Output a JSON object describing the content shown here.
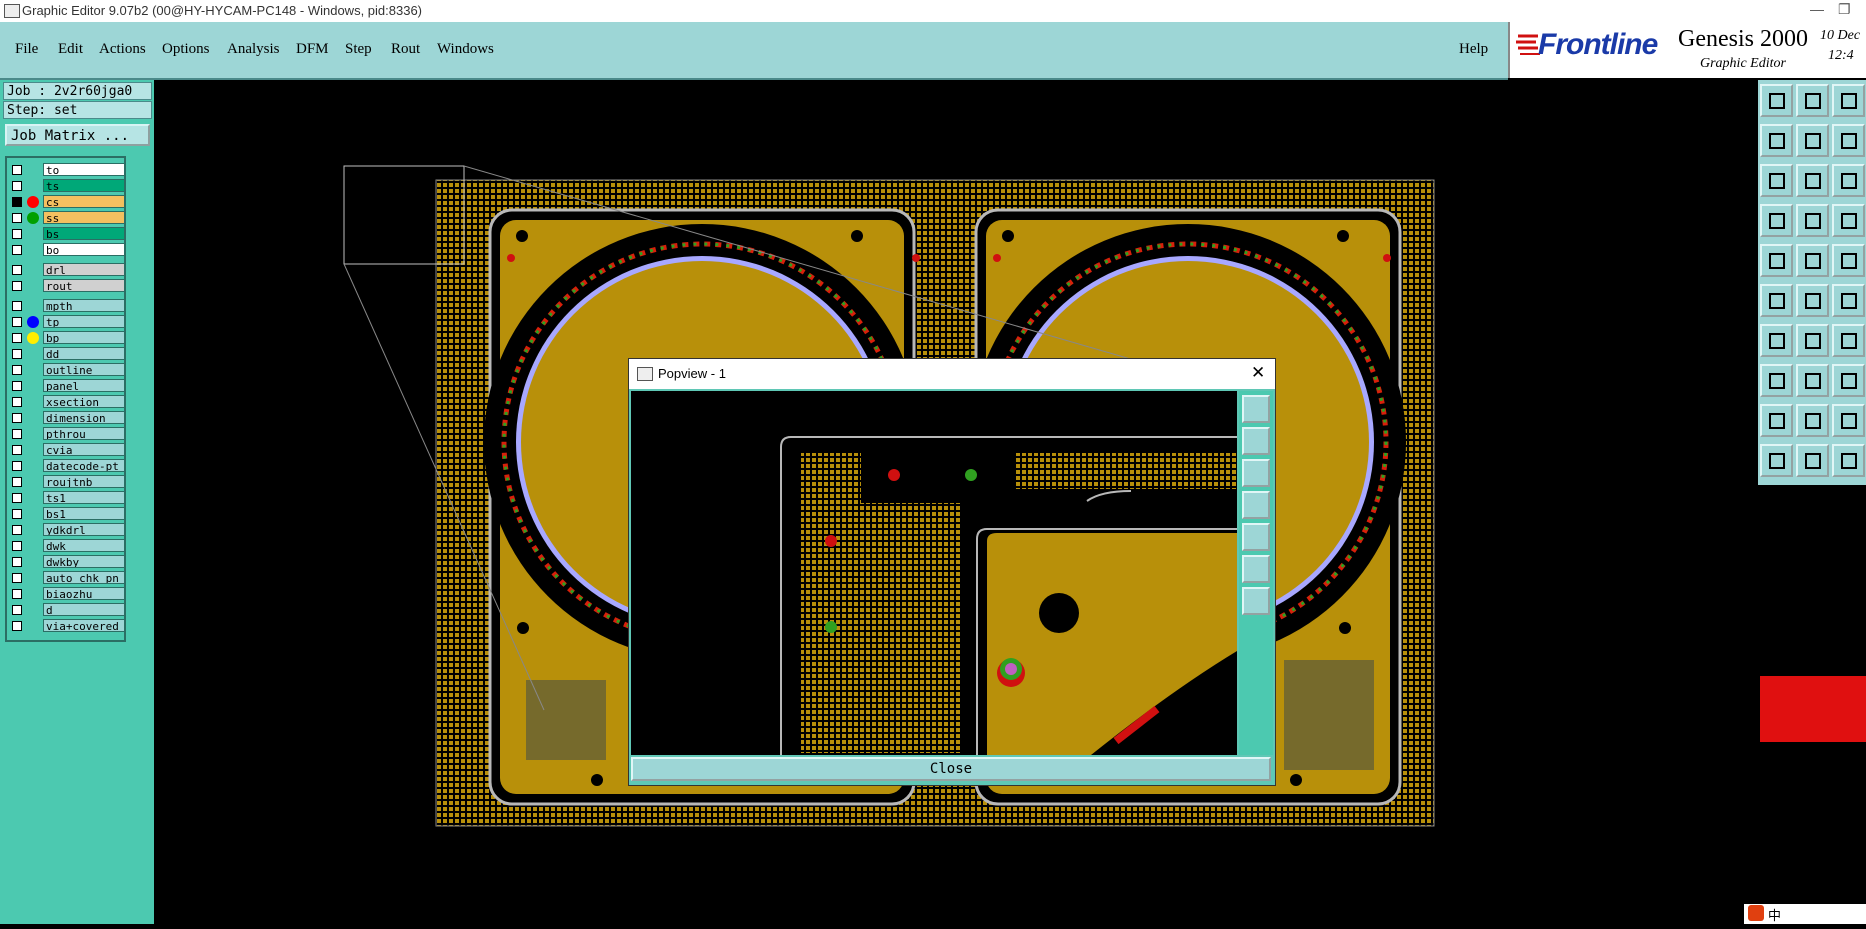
{
  "window": {
    "title": "Graphic Editor 9.07b2 (00@HY-HYCAM-PC148 - Windows, pid:8336)",
    "controls": [
      "—",
      "❐"
    ]
  },
  "menubar": {
    "items": [
      "File",
      "Edit",
      "Actions",
      "Options",
      "Analysis",
      "DFM",
      "Step",
      "Rout",
      "Windows"
    ],
    "help": "Help"
  },
  "brand": {
    "logo": "Frontline",
    "product": "Genesis 2000",
    "subtitle": "Graphic Editor",
    "date_line1": "10  Dec",
    "date_line2": "12:4"
  },
  "job": {
    "job_line": "Job : 2v2r60jga0",
    "step_line": "Step: set",
    "matrix_button": "Job Matrix ..."
  },
  "layers": [
    {
      "name": "to",
      "bg": "#ffffff",
      "dot": ""
    },
    {
      "name": "ts",
      "bg": "#00a878",
      "dot": ""
    },
    {
      "name": "cs",
      "bg": "#f4c060",
      "dot": "#ff0000",
      "active": true
    },
    {
      "name": "ss",
      "bg": "#f4c060",
      "dot": "#00a000"
    },
    {
      "name": "bs",
      "bg": "#00a878",
      "dot": ""
    },
    {
      "name": "bo",
      "bg": "#ffffff",
      "dot": ""
    },
    {
      "name": "drl",
      "bg": "#d0d0d0",
      "dot": ""
    },
    {
      "name": "rout",
      "bg": "#d0d0d0",
      "dot": ""
    },
    {
      "name": "mpth",
      "bg": "#9dd6d6",
      "dot": ""
    },
    {
      "name": "tp",
      "bg": "#9dd6d6",
      "dot": "#0000ff"
    },
    {
      "name": "bp",
      "bg": "#9dd6d6",
      "dot": "#ffee00"
    },
    {
      "name": "dd",
      "bg": "#9dd6d6",
      "dot": ""
    },
    {
      "name": "outline",
      "bg": "#9dd6d6",
      "dot": ""
    },
    {
      "name": "panel",
      "bg": "#9dd6d6",
      "dot": ""
    },
    {
      "name": "xsection",
      "bg": "#9dd6d6",
      "dot": ""
    },
    {
      "name": "dimension",
      "bg": "#9dd6d6",
      "dot": ""
    },
    {
      "name": "pthrou",
      "bg": "#9dd6d6",
      "dot": ""
    },
    {
      "name": "cvia",
      "bg": "#9dd6d6",
      "dot": ""
    },
    {
      "name": "datecode-pt",
      "bg": "#9dd6d6",
      "dot": ""
    },
    {
      "name": "roujtnb",
      "bg": "#9dd6d6",
      "dot": ""
    },
    {
      "name": "ts1",
      "bg": "#9dd6d6",
      "dot": ""
    },
    {
      "name": "bs1",
      "bg": "#9dd6d6",
      "dot": ""
    },
    {
      "name": "ydkdrl",
      "bg": "#9dd6d6",
      "dot": ""
    },
    {
      "name": "dwk",
      "bg": "#9dd6d6",
      "dot": ""
    },
    {
      "name": "dwkby",
      "bg": "#9dd6d6",
      "dot": ""
    },
    {
      "name": "auto_chk_pn",
      "bg": "#9dd6d6",
      "dot": ""
    },
    {
      "name": "biaozhu",
      "bg": "#9dd6d6",
      "dot": ""
    },
    {
      "name": "d",
      "bg": "#9dd6d6",
      "dot": ""
    },
    {
      "name": "via+covered",
      "bg": "#9dd6d6",
      "dot": ""
    }
  ],
  "popview": {
    "title": "Popview - 1",
    "close_button": "Close"
  },
  "right_tools": [
    "home-icon",
    "zoom-in-icon",
    "house-icon",
    "pan-left-icon",
    "pan-right-icon",
    "redo-icon",
    "fit-icon",
    "center-icon",
    "scale-icon",
    "sweep-icon",
    "grid-icon",
    "measure-icon",
    "select-icon",
    "line-icon",
    "ruler-icon",
    "snap-icon",
    "cross-icon",
    "arc-icon",
    "pencil-icon",
    "angle-icon",
    "rotate-icon",
    "node-icon",
    "minus-icon",
    "align-icon",
    "triangle-icon",
    "triangle-alt-icon",
    "peak-icon",
    "pointer-icon",
    "pointer-alt-icon",
    "pointer-red-icon"
  ],
  "colors": {
    "board_copper": "#b8900a",
    "ring_blue": "#a8a8ff",
    "ring_black": "#000000",
    "panel_cyan": "#9dd6d6",
    "left_teal": "#4cc9b0"
  },
  "ime": {
    "label": "中"
  }
}
